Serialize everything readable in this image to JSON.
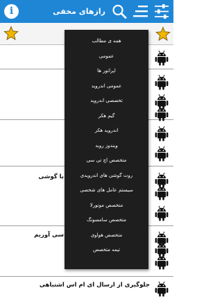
{
  "header": {
    "title": "رازهای مخفی",
    "info_glyph": "i",
    "background": "#1f86d6"
  },
  "list": {
    "visible_texts": [
      "با گوشی",
      "سی آوریم",
      "جلوگیری از ارسال ای ام اس اشتباهی"
    ]
  },
  "menu": {
    "items": [
      "همه ی مطالب",
      "عمومی",
      "اپراتور ها",
      "عمومی اندروید",
      "تخصصی اندروید",
      "گیم هکر",
      "اندروید هکر",
      "ویندوز روید",
      "متخصص اچ تی سی",
      "روت گوشی های اندرویدی",
      "سیستم عامل های شخصی",
      "متخصص موتورلا",
      "متخصص سامسونگ",
      "متخصص هواوی",
      "تیمه متخصص"
    ]
  },
  "colors": {
    "accent": "#1f86d6",
    "star": "#f2b600",
    "android": "#111111",
    "menu_bg": "#1e1e1e"
  }
}
